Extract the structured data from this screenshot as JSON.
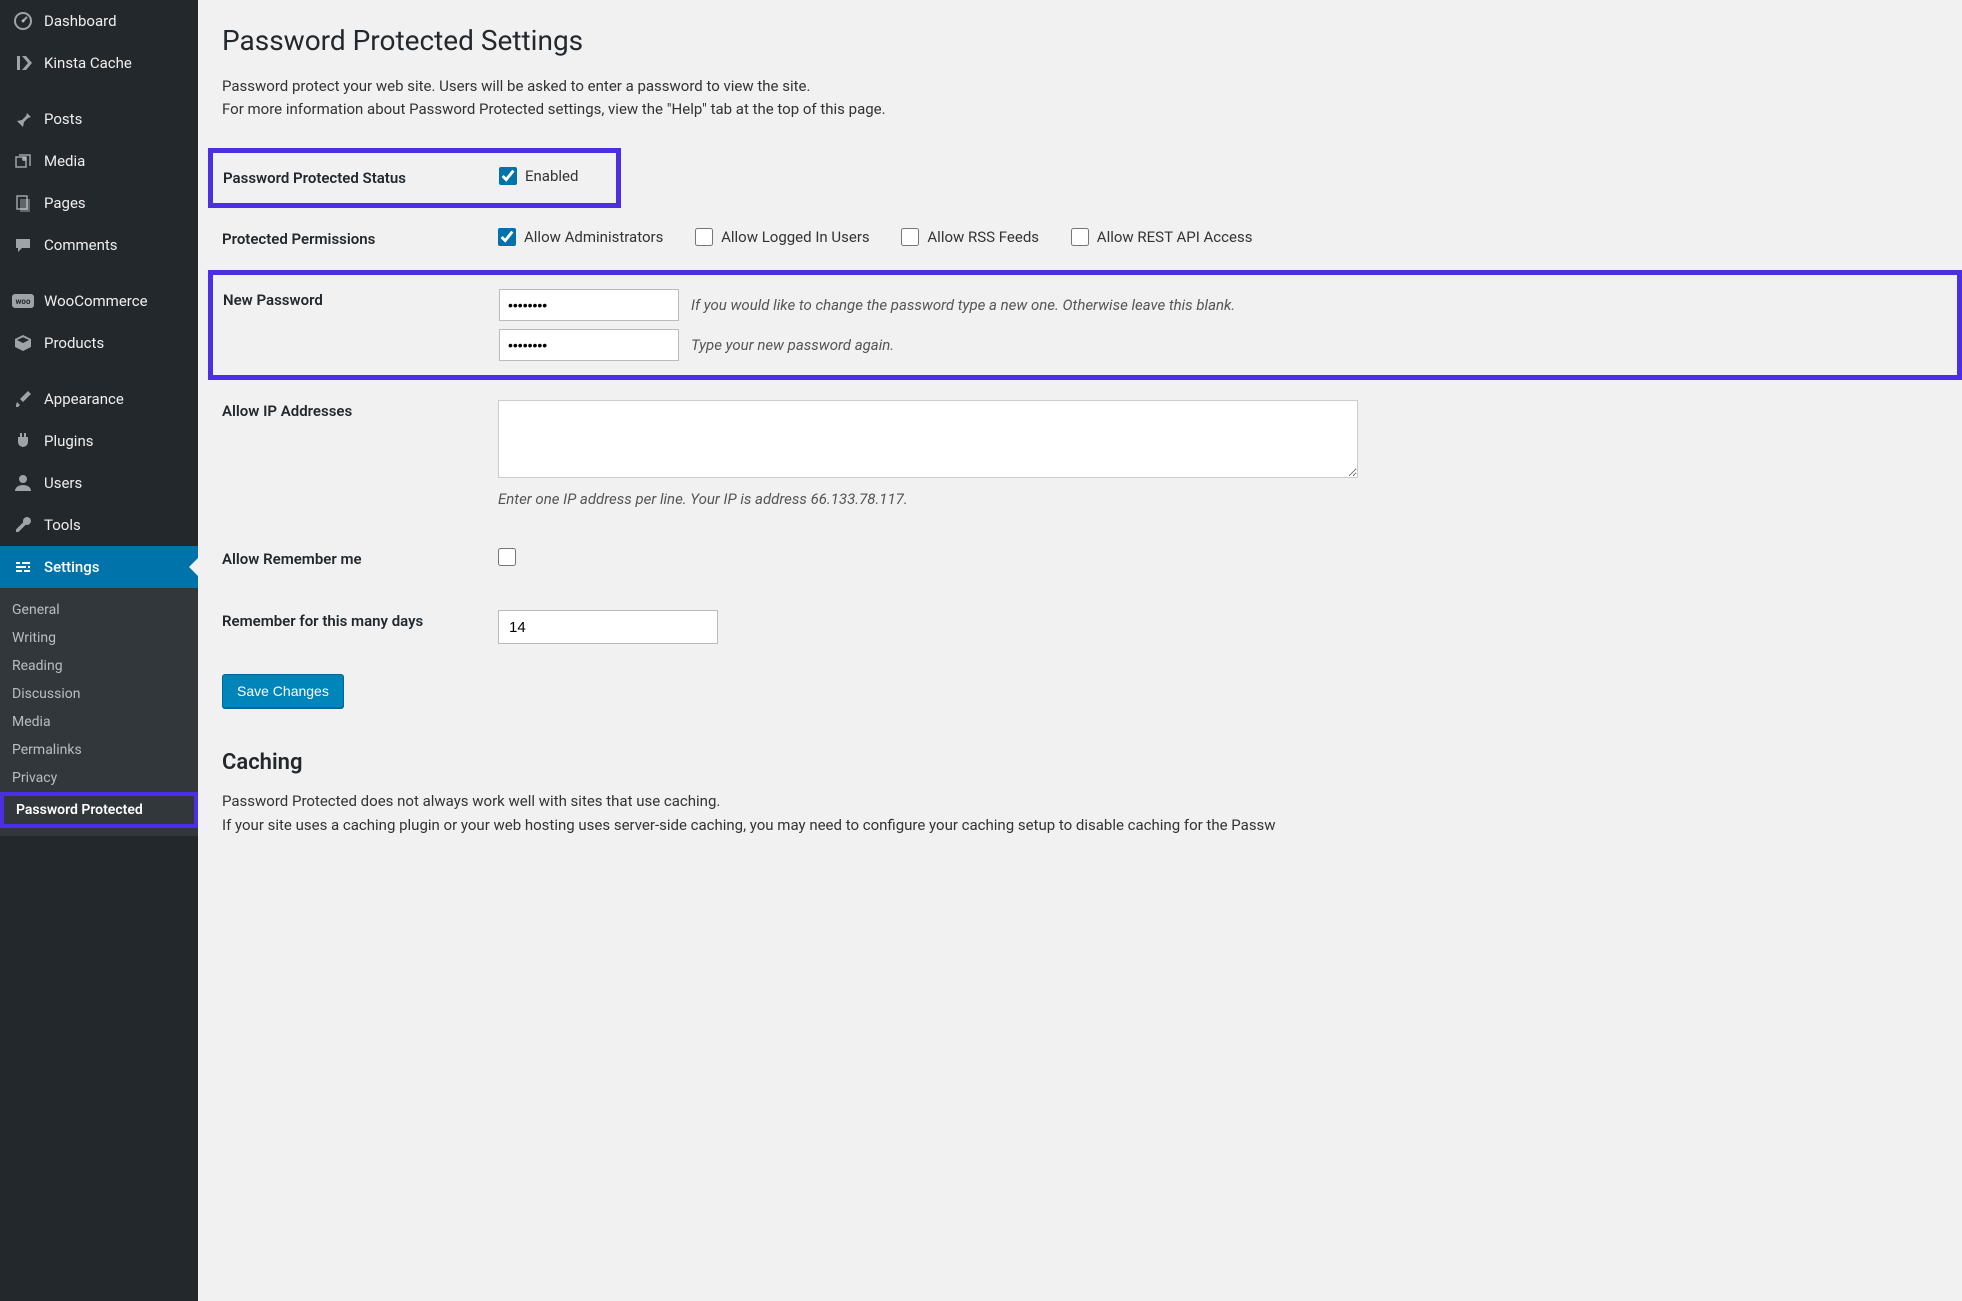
{
  "sidebar": {
    "items": [
      {
        "label": "Dashboard"
      },
      {
        "label": "Kinsta Cache"
      },
      {
        "label": "Posts"
      },
      {
        "label": "Media"
      },
      {
        "label": "Pages"
      },
      {
        "label": "Comments"
      },
      {
        "label": "WooCommerce"
      },
      {
        "label": "Products"
      },
      {
        "label": "Appearance"
      },
      {
        "label": "Plugins"
      },
      {
        "label": "Users"
      },
      {
        "label": "Tools"
      },
      {
        "label": "Settings"
      }
    ],
    "submenu": [
      {
        "label": "General"
      },
      {
        "label": "Writing"
      },
      {
        "label": "Reading"
      },
      {
        "label": "Discussion"
      },
      {
        "label": "Media"
      },
      {
        "label": "Permalinks"
      },
      {
        "label": "Privacy"
      },
      {
        "label": "Password Protected"
      }
    ]
  },
  "page": {
    "title": "Password Protected Settings",
    "intro_line1": "Password protect your web site. Users will be asked to enter a password to view the site.",
    "intro_line2": "For more information about Password Protected settings, view the \"Help\" tab at the top of this page."
  },
  "fields": {
    "status_label": "Password Protected Status",
    "status_enabled_label": "Enabled",
    "permissions_label": "Protected Permissions",
    "perm_admins": "Allow Administrators",
    "perm_logged_in": "Allow Logged In Users",
    "perm_rss": "Allow RSS Feeds",
    "perm_rest": "Allow REST API Access",
    "new_password_label": "New Password",
    "pw_desc1": "If you would like to change the password type a new one. Otherwise leave this blank.",
    "pw_desc2": "Type your new password again.",
    "pw_value": "••••••••",
    "allow_ip_label": "Allow IP Addresses",
    "ip_desc": "Enter one IP address per line. Your IP is address 66.133.78.117.",
    "allow_remember_label": "Allow Remember me",
    "remember_days_label": "Remember for this many days",
    "remember_days_value": "14",
    "save_label": "Save Changes"
  },
  "caching": {
    "heading": "Caching",
    "line1": "Password Protected does not always work well with sites that use caching.",
    "line2": "If your site uses a caching plugin or your web hosting uses server-side caching, you may need to configure your caching setup to disable caching for the Passw"
  }
}
